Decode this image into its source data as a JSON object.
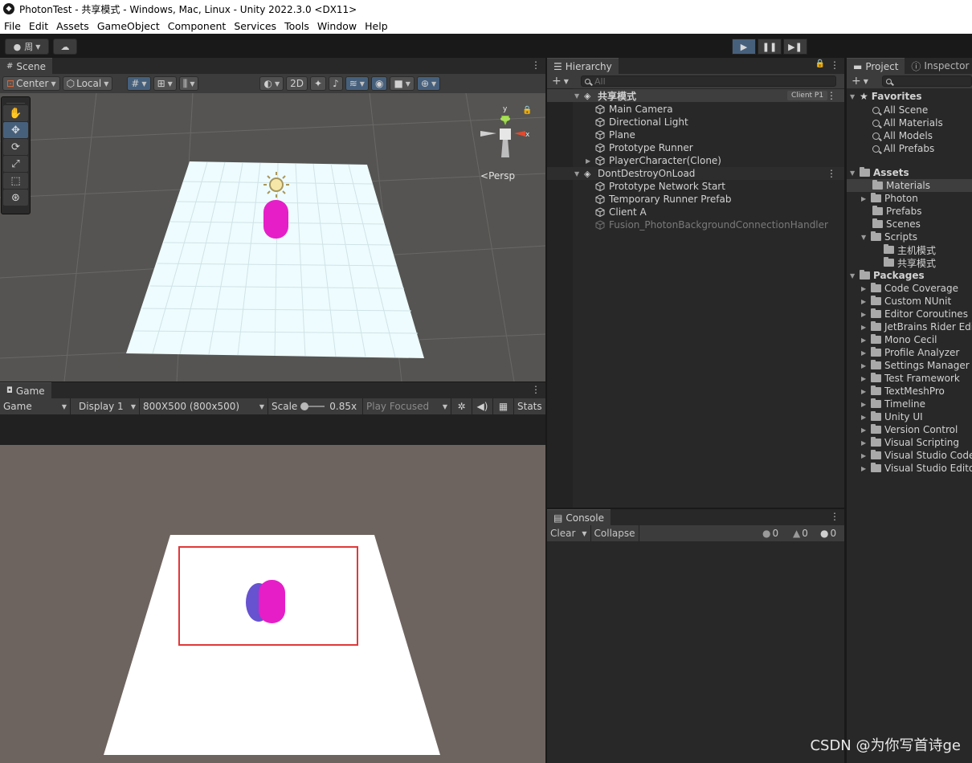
{
  "window": {
    "title": "PhotonTest - 共享模式 - Windows, Mac, Linux - Unity 2022.3.0 <DX11>"
  },
  "menu": [
    "File",
    "Edit",
    "Assets",
    "GameObject",
    "Component",
    "Services",
    "Tools",
    "Window",
    "Help"
  ],
  "toolbar": {
    "account_label": "周",
    "play": "▶",
    "pause": "❚❚",
    "step": "▶❚"
  },
  "scene": {
    "tab": "Scene",
    "pivot_mode": "Center",
    "pivot_rotation": "Local",
    "mode_2d": "2D",
    "persp_label": "Persp",
    "axis_y": "y",
    "axis_x": "x"
  },
  "game": {
    "tab": "Game",
    "mode": "Game",
    "display": "Display 1",
    "resolution": "800X500 (800x500)",
    "scale_label": "Scale",
    "scale_value": "0.85x",
    "play_focused": "Play Focused",
    "stats": "Stats"
  },
  "hierarchy": {
    "tab": "Hierarchy",
    "search_placeholder": "All",
    "scene_name": "共享模式",
    "client_badge": "Client P1",
    "scene_items": [
      "Main Camera",
      "Directional Light",
      "Plane",
      "Prototype Runner",
      "PlayerCharacter(Clone)"
    ],
    "ddol_name": "DontDestroyOnLoad",
    "ddol_items": [
      "Prototype Network Start",
      "Temporary Runner Prefab",
      "Client A"
    ],
    "ddol_disabled_item": "Fusion_PhotonBackgroundConnectionHandler"
  },
  "console": {
    "tab": "Console",
    "clear": "Clear",
    "collapse": "Collapse",
    "info_count": "0",
    "warn_count": "0",
    "error_count": "0"
  },
  "project": {
    "tab_project": "Project",
    "tab_inspector": "Inspector",
    "favorites_label": "Favorites",
    "favorites": [
      "All Scene",
      "All Materials",
      "All Models",
      "All Prefabs"
    ],
    "assets_label": "Assets",
    "assets": [
      "Materials",
      "Photon",
      "Prefabs",
      "Scenes",
      "Scripts"
    ],
    "scripts_children": [
      "主机模式",
      "共享模式"
    ],
    "packages_label": "Packages",
    "packages": [
      "Code Coverage",
      "Custom NUnit",
      "Editor Coroutines",
      "JetBrains Rider Edit",
      "Mono Cecil",
      "Profile Analyzer",
      "Settings Manager",
      "Test Framework",
      "TextMeshPro",
      "Timeline",
      "Unity UI",
      "Version Control",
      "Visual Scripting",
      "Visual Studio Code",
      "Visual Studio Editor"
    ]
  },
  "watermark": "CSDN @为你写首诗ge",
  "colors": {
    "capsule": "#e61ec8",
    "highlight_box": "#e0383a",
    "plane": "#eefcff",
    "accent": "#46607c"
  }
}
